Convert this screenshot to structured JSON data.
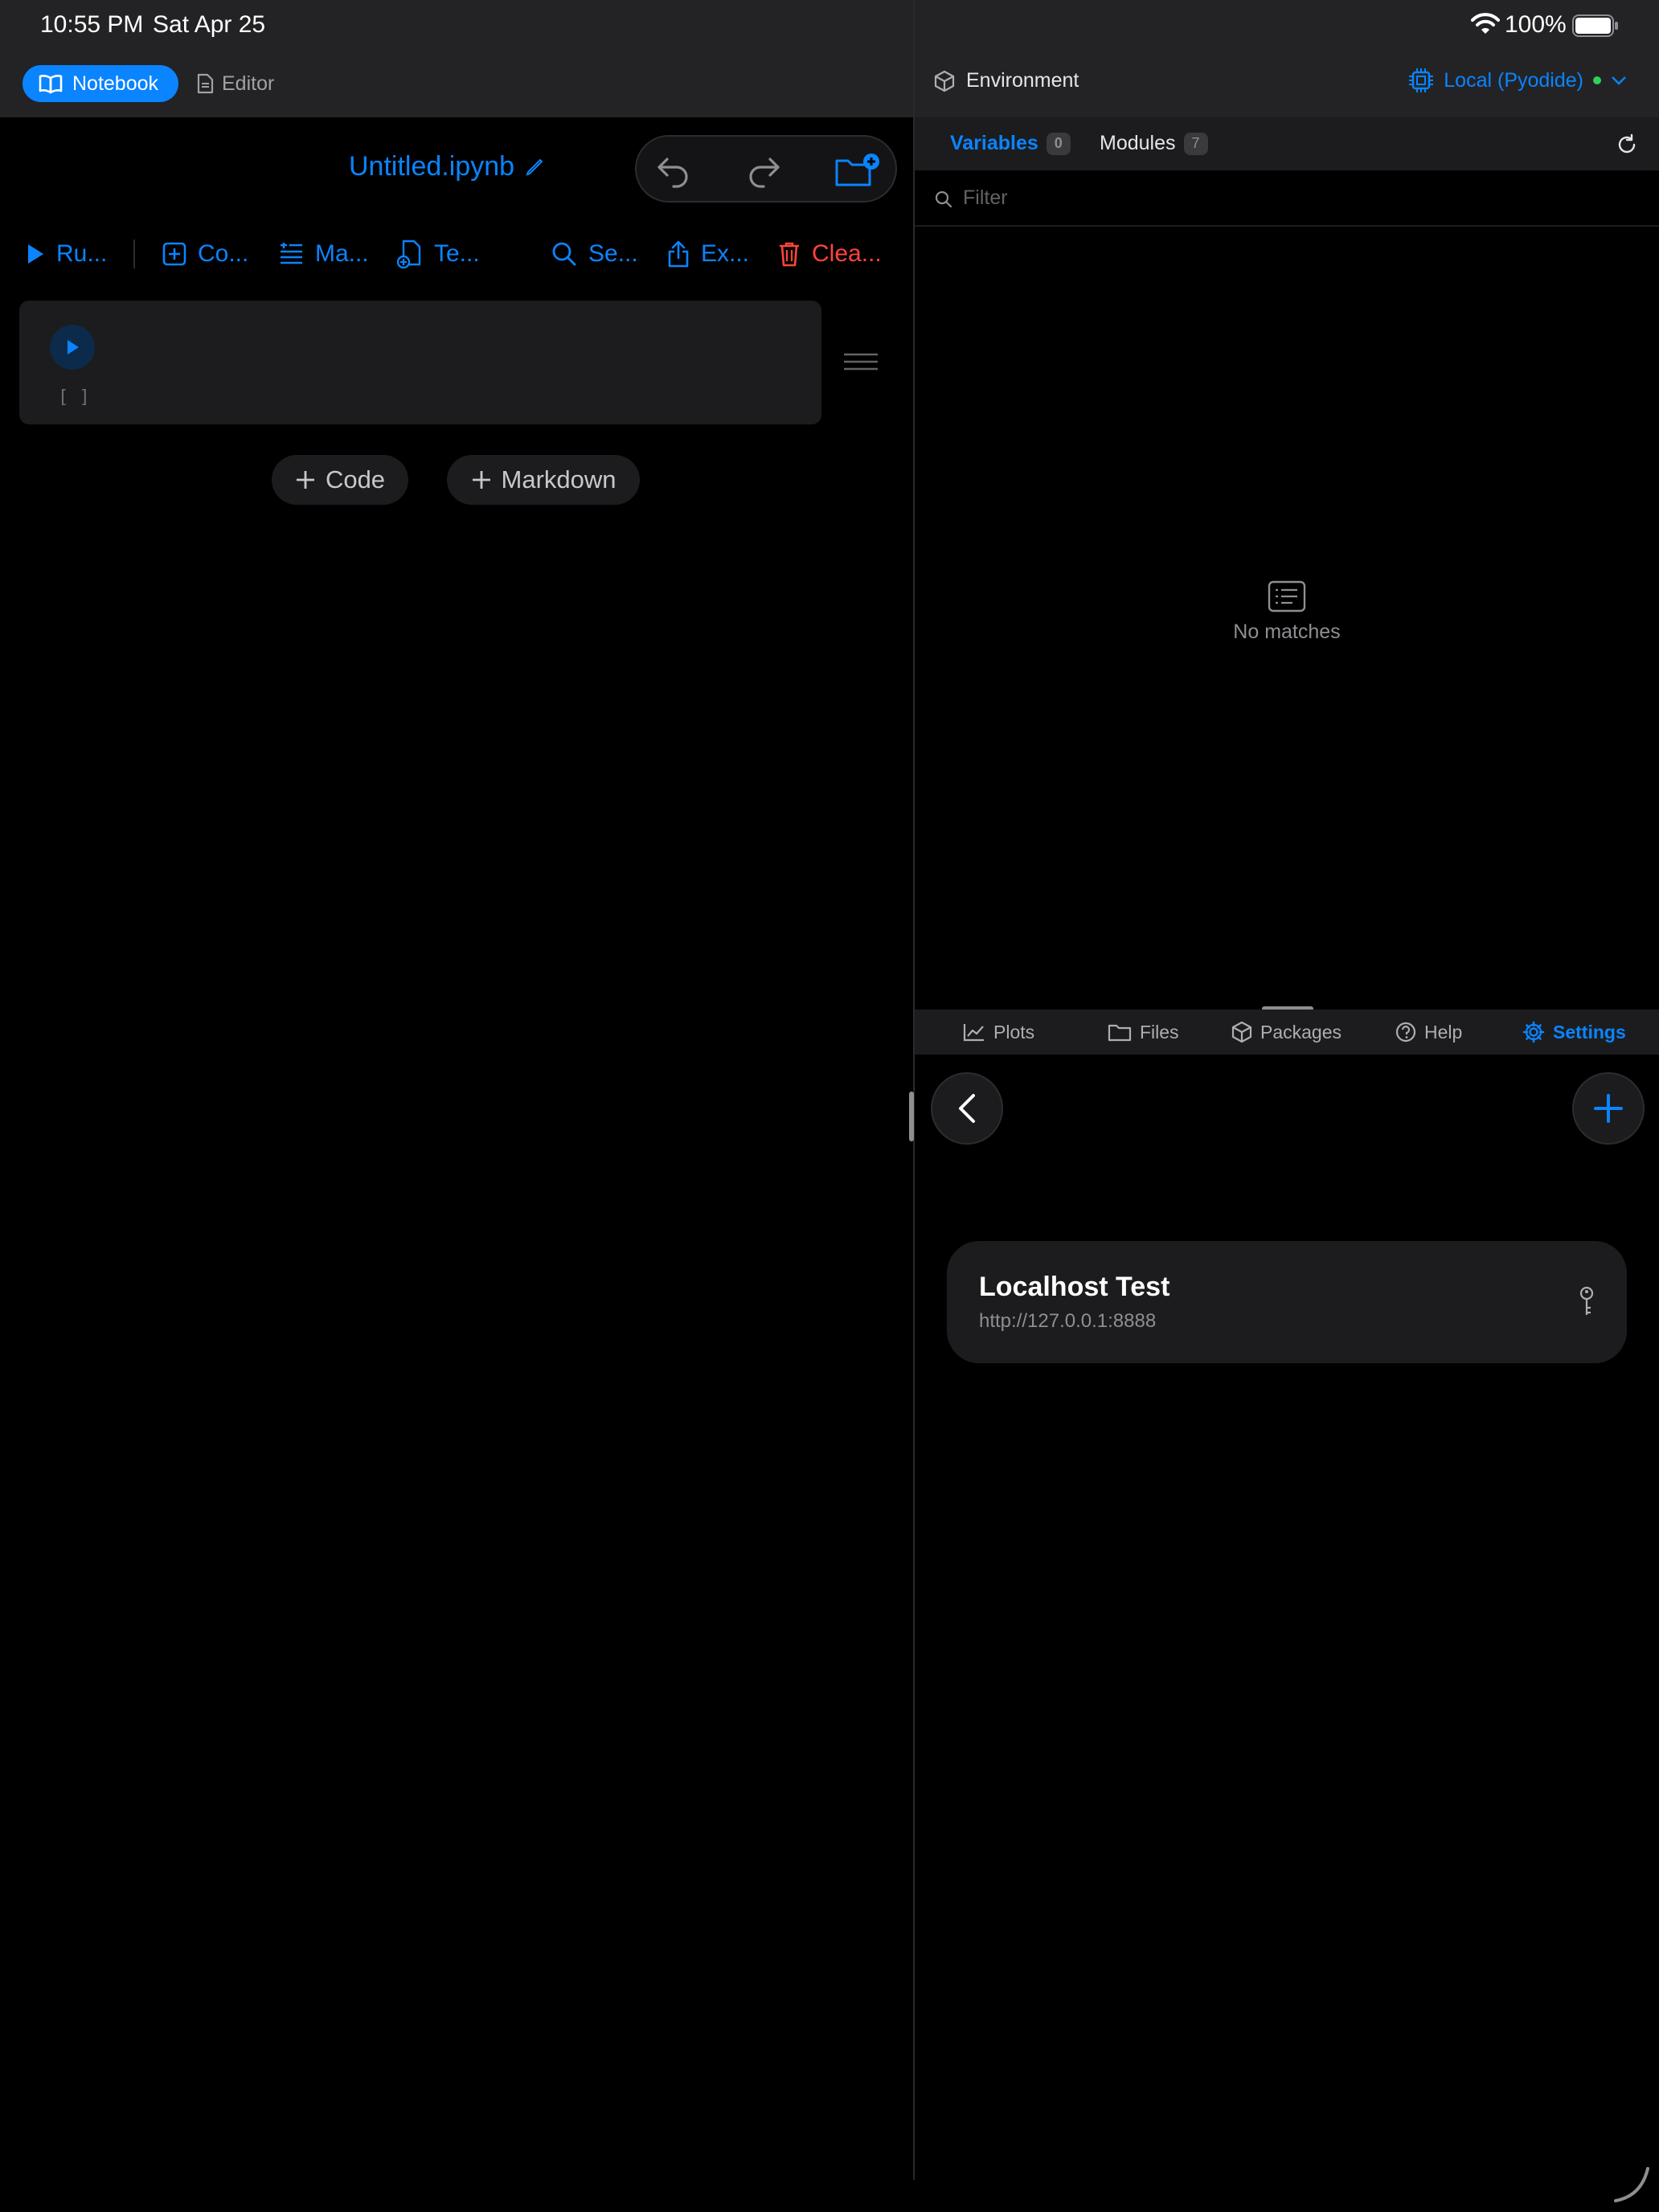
{
  "status_bar": {
    "time": "10:55 PM",
    "date": "Sat Apr 25",
    "battery": "100%"
  },
  "mode_switch": {
    "notebook": "Notebook",
    "editor": "Editor"
  },
  "document": {
    "title": "Untitled.ipynb"
  },
  "toolbar": {
    "run": "Ru...",
    "code": "Co...",
    "markdown": "Ma...",
    "template": "Te...",
    "search": "Se...",
    "export": "Ex...",
    "clear": "Clea..."
  },
  "cell": {
    "execution_count": "[ ]"
  },
  "add_cell": {
    "code": "Code",
    "markdown": "Markdown"
  },
  "environment": {
    "title": "Environment",
    "runtime": "Local (Pyodide)",
    "tabs": [
      {
        "label": "Variables",
        "count": "0"
      },
      {
        "label": "Modules",
        "count": "7"
      }
    ],
    "filter_placeholder": "Filter",
    "empty_text": "No matches"
  },
  "bottom_tabs": [
    {
      "label": "Plots",
      "icon": "chart-icon"
    },
    {
      "label": "Files",
      "icon": "folder-icon"
    },
    {
      "label": "Packages",
      "icon": "package-icon"
    },
    {
      "label": "Help",
      "icon": "help-icon"
    },
    {
      "label": "Settings",
      "icon": "gear-icon"
    }
  ],
  "server": {
    "name": "Localhost Test",
    "url": "http://127.0.0.1:8888"
  },
  "colors": {
    "accent": "#0a84ff",
    "danger": "#ff453a",
    "status_ok": "#30d158"
  }
}
